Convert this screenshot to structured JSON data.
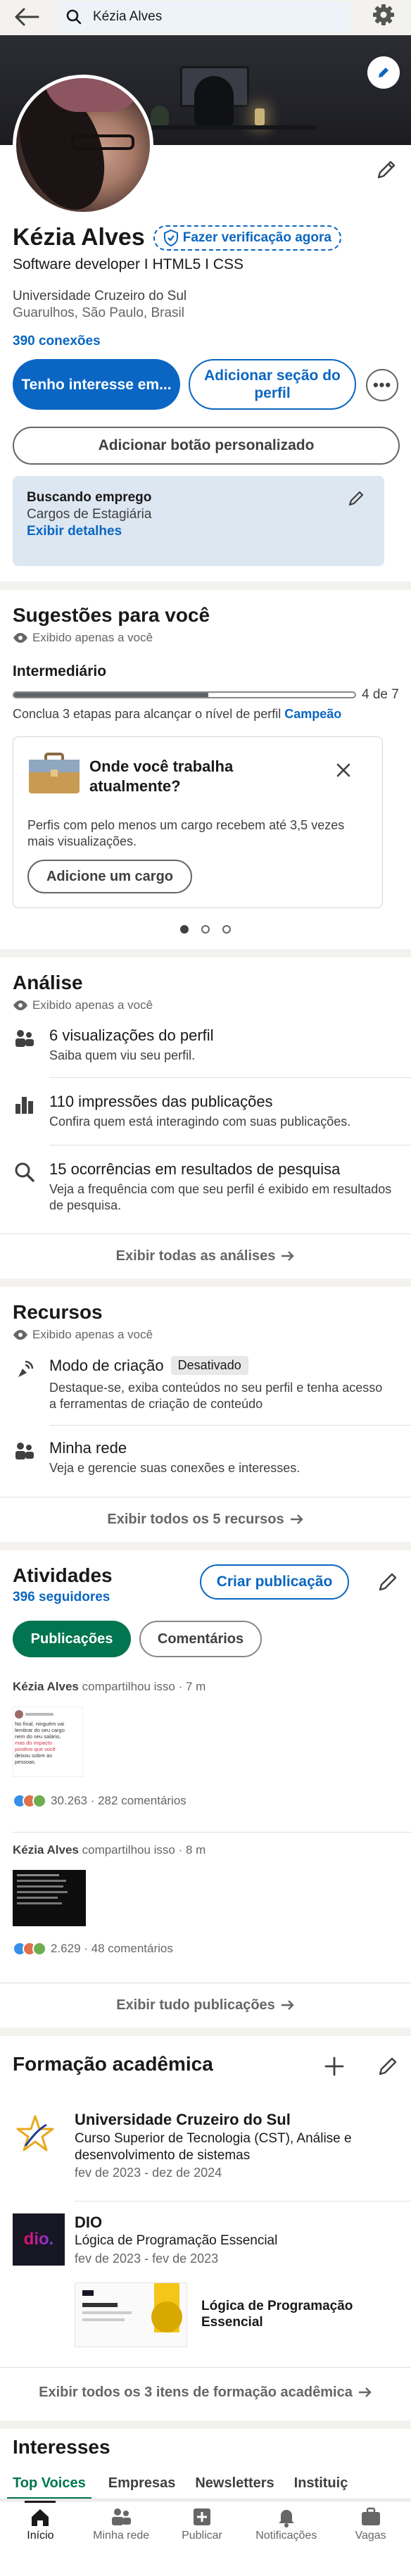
{
  "topbar": {
    "search_value": "Kézia Alves"
  },
  "profile": {
    "name": "Kézia Alves",
    "verify_label": "Fazer verificação agora",
    "headline": "Software developer I HTML5 I CSS",
    "education": "Universidade Cruzeiro do Sul",
    "location": "Guarulhos, São Paulo, Brasil",
    "connections": "390 conexões",
    "btn_interest": "Tenho interesse em...",
    "btn_add_section": "Adicionar seção do perfil",
    "btn_custom": "Adicionar botão personalizado"
  },
  "open_to": {
    "title": "Buscando emprego",
    "detail": "Cargos de Estagiária",
    "link": "Exibir detalhes"
  },
  "suggestions": {
    "title": "Sugestões para você",
    "private": "Exibido apenas a você",
    "level": "Intermediário",
    "progress": "4 de 7",
    "progress_fraction": 0.57,
    "hint_prefix": "Conclua 3 etapas para alcançar o nível de perfil",
    "hint_level": "Campeão",
    "card_title": "Onde você trabalha atualmente?",
    "card_text": "Perfis com pelo menos um cargo recebem até 3,5 vezes mais visualizações.",
    "card_button": "Adicione um cargo"
  },
  "analytics": {
    "title": "Análise",
    "private": "Exibido apenas a você",
    "items": [
      {
        "title": "6 visualizações do perfil",
        "sub": "Saiba quem viu seu perfil."
      },
      {
        "title": "110 impressões das publicações",
        "sub": "Confira quem está interagindo com suas publicações."
      },
      {
        "title": "15 ocorrências em resultados de pesquisa",
        "sub": "Veja a frequência com que seu perfil é exibido em resultados de pesquisa."
      }
    ],
    "show_all": "Exibir todas as análises"
  },
  "resources": {
    "title": "Recursos",
    "private": "Exibido apenas a você",
    "creator_title": "Modo de criação",
    "creator_badge": "Desativado",
    "creator_sub": "Destaque-se, exiba conteúdos no seu perfil e tenha acesso a ferramentas de criação de conteúdo",
    "network_title": "Minha rede",
    "network_sub": "Veja e gerencie suas conexões e interesses.",
    "show_all": "Exibir todos os 5 recursos"
  },
  "activity": {
    "title": "Atividades",
    "followers": "396 seguidores",
    "create": "Criar publicação",
    "tab_posts": "Publicações",
    "tab_comments": "Comentários",
    "posts": [
      {
        "author": "Kézia Alves",
        "meta": "compartilhou isso · 7 m",
        "stats": "30.263 · 282 comentários"
      },
      {
        "author": "Kézia Alves",
        "meta": "compartilhou isso · 8 m",
        "stats": "2.629 · 48 comentários"
      }
    ],
    "thumb1_lines": [
      "No final, ninguém vai",
      "lembrar do seu cargo",
      "nem do seu salário,",
      "mas do impacto",
      "positivo que você",
      "deixou sobre as",
      "pessoas."
    ],
    "show_all": "Exibir tudo publicações"
  },
  "education_section": {
    "title": "Formação acadêmica",
    "items": [
      {
        "school": "Universidade Cruzeiro do Sul",
        "degree": "Curso Superior de Tecnologia (CST), Análise e desenvolvimento de sistemas",
        "dates": "fev de 2023 - dez de 2024"
      },
      {
        "school": "DIO",
        "degree": "Lógica de Programação Essencial",
        "dates": "fev de 2023 - fev de 2023"
      }
    ],
    "dio_logo": "dio.",
    "media_title": "Lógica de Programação Essencial",
    "show_all": "Exibir todos os 3 itens de formação acadêmica"
  },
  "interests": {
    "title": "Interesses",
    "tabs": [
      "Top Voices",
      "Empresas",
      "Newsletters",
      "Instituiç"
    ]
  },
  "bottom_nav": [
    "Início",
    "Minha rede",
    "Publicar",
    "Notificações",
    "Vagas"
  ],
  "colors": {
    "accent": "#0a66c2",
    "green": "#057642",
    "gold": "#f5c518"
  }
}
